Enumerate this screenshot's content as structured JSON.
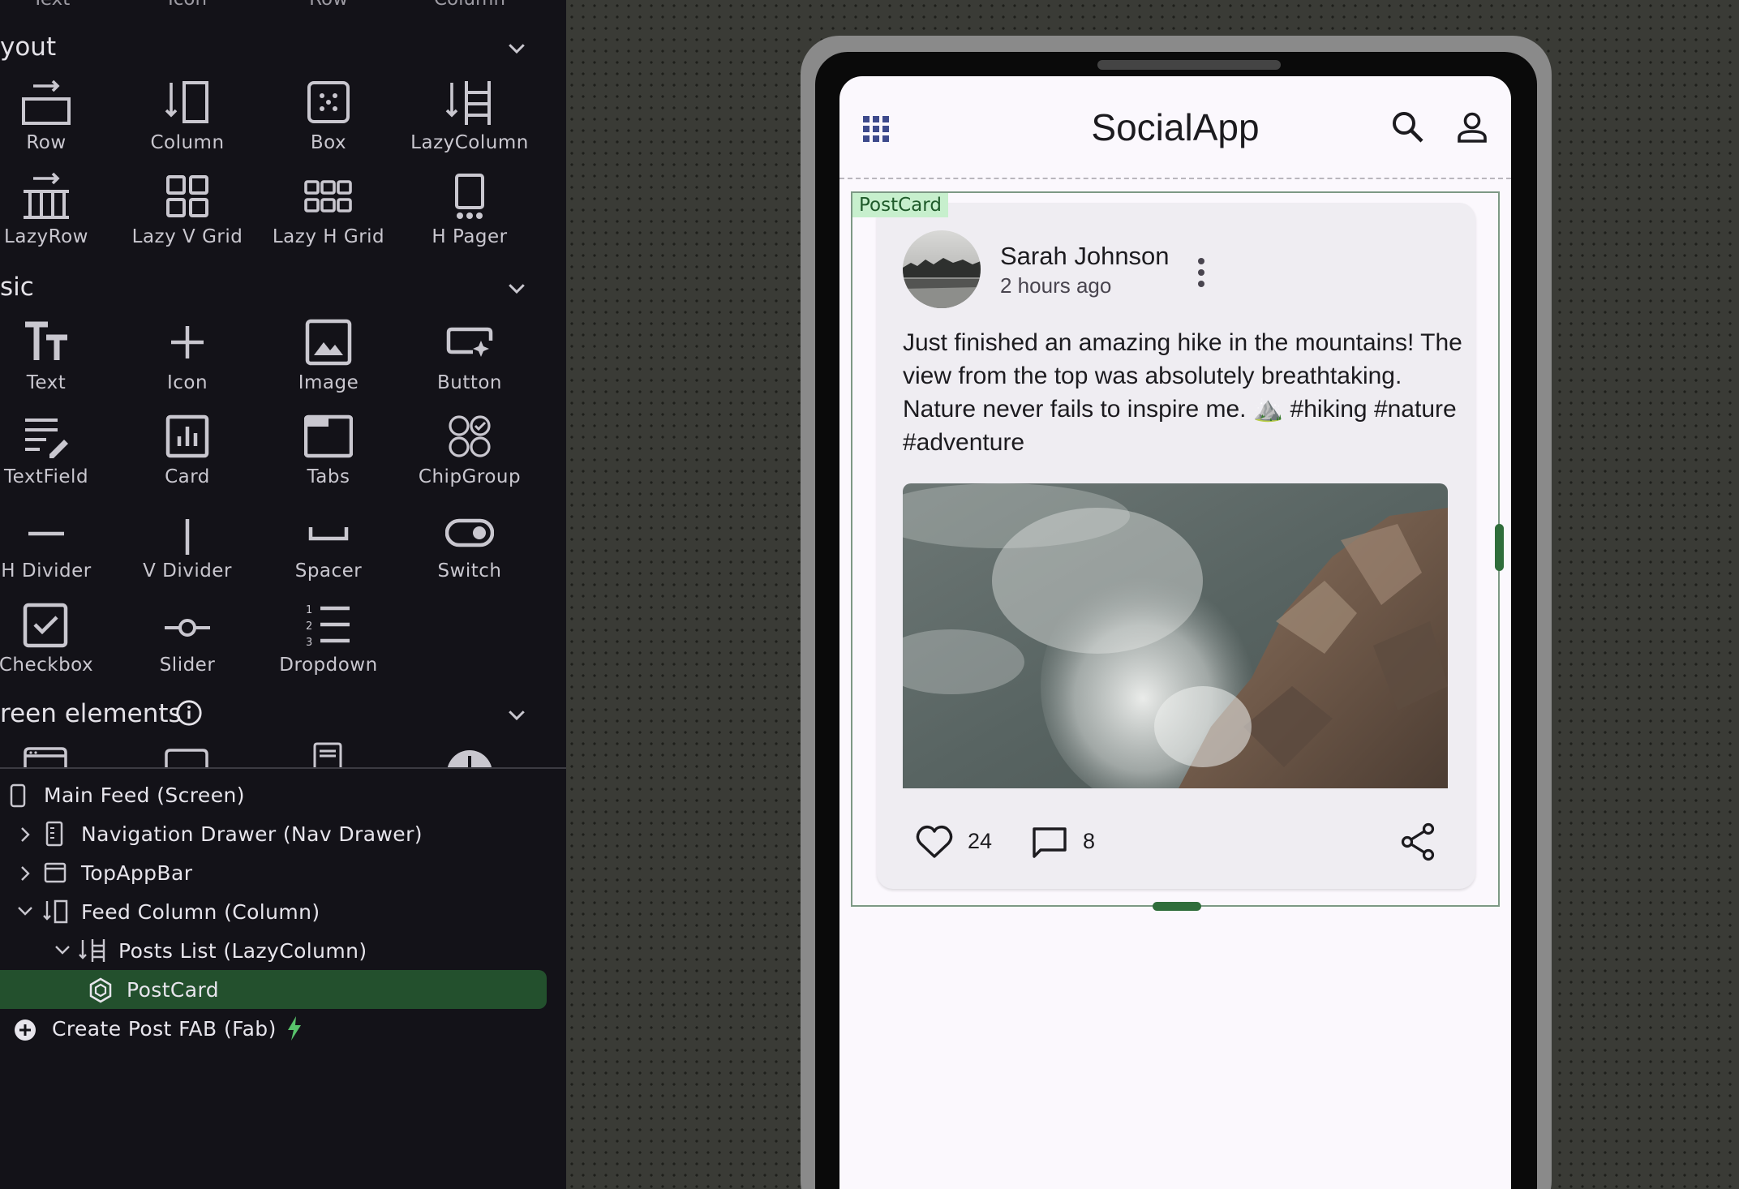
{
  "palette": {
    "top_row_cut": [
      "Text",
      "Icon",
      "Row",
      "Column"
    ],
    "layout": {
      "title": "yout",
      "items": [
        "Row",
        "Column",
        "Box",
        "LazyColumn",
        "LazyRow",
        "Lazy V Grid",
        "Lazy H Grid",
        "H Pager"
      ]
    },
    "basic": {
      "title": "sic",
      "items": [
        "Text",
        "Icon",
        "Image",
        "Button",
        "TextField",
        "Card",
        "Tabs",
        "ChipGroup",
        "H Divider",
        "V Divider",
        "Spacer",
        "Switch",
        "Checkbox",
        "Slider",
        "Dropdown"
      ]
    },
    "screen_elements": {
      "title": "reen elements"
    }
  },
  "tree": {
    "items": [
      "Main Feed (Screen)",
      "Navigation Drawer (Nav Drawer)",
      "TopAppBar",
      "Feed Column (Column)",
      "Posts List (LazyColumn)",
      "PostCard",
      "Create Post FAB (Fab)"
    ]
  },
  "app": {
    "title": "SocialApp",
    "selection_tag": "PostCard",
    "post": {
      "author": "Sarah Johnson",
      "time": "2 hours ago",
      "text": "Just finished an amazing hike in the mountains! The view from the top was absolutely breathtaking. Nature never fails to inspire me. ⛰️ #hiking #nature #adventure",
      "likes": "24",
      "comments": "8"
    }
  },
  "colors": {
    "panel_bg": "#131218",
    "selected_row": "#23502d",
    "accent_green": "#2f6d3b",
    "tag_bg": "#c7efcd",
    "app_icon_blue": "#3d4a8c"
  }
}
